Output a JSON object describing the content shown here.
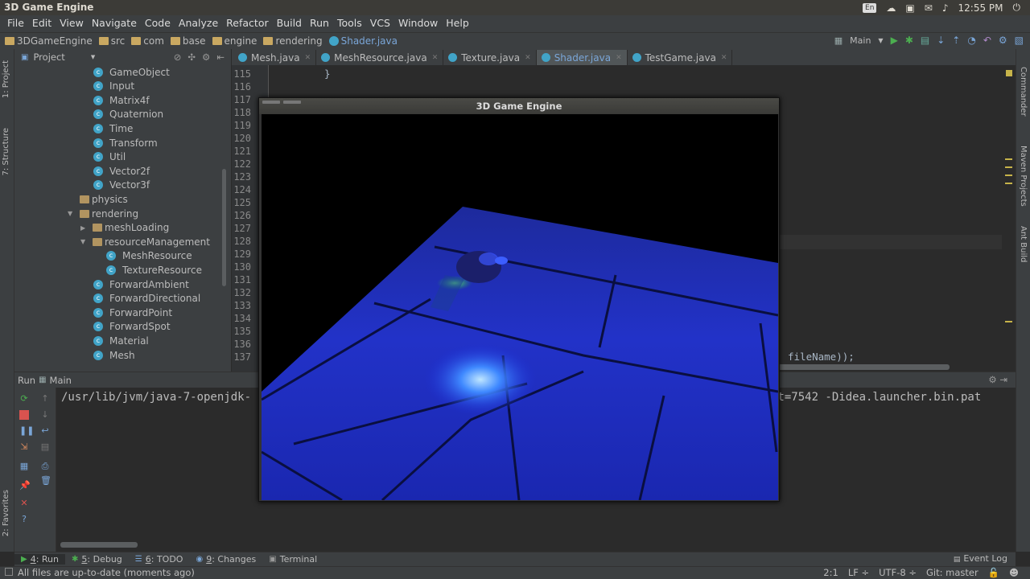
{
  "system": {
    "window_title": "3D Game Engine",
    "lang": "En",
    "clock": "12:55 PM"
  },
  "menu": [
    "File",
    "Edit",
    "View",
    "Navigate",
    "Code",
    "Analyze",
    "Refactor",
    "Build",
    "Run",
    "Tools",
    "VCS",
    "Window",
    "Help"
  ],
  "breadcrumb": [
    {
      "label": "3DGameEngine",
      "kind": "project"
    },
    {
      "label": "src",
      "kind": "folder"
    },
    {
      "label": "com",
      "kind": "folder"
    },
    {
      "label": "base",
      "kind": "folder"
    },
    {
      "label": "engine",
      "kind": "folder"
    },
    {
      "label": "rendering",
      "kind": "folder"
    },
    {
      "label": "Shader.java",
      "kind": "class"
    }
  ],
  "run_config": "Main",
  "left_tool_windows": [
    "1: Project",
    "7: Structure",
    "2: Favorites"
  ],
  "right_tool_windows": [
    "Commander",
    "Maven Projects",
    "Ant Build"
  ],
  "project_panel": {
    "title": "Project",
    "tree": [
      {
        "label": "GameObject",
        "kind": "class",
        "depth": 2
      },
      {
        "label": "Input",
        "kind": "class",
        "depth": 2
      },
      {
        "label": "Matrix4f",
        "kind": "class",
        "depth": 2
      },
      {
        "label": "Quaternion",
        "kind": "class",
        "depth": 2
      },
      {
        "label": "Time",
        "kind": "class",
        "depth": 2
      },
      {
        "label": "Transform",
        "kind": "class",
        "depth": 2
      },
      {
        "label": "Util",
        "kind": "class",
        "depth": 2
      },
      {
        "label": "Vector2f",
        "kind": "class",
        "depth": 2
      },
      {
        "label": "Vector3f",
        "kind": "class",
        "depth": 2
      },
      {
        "label": "physics",
        "kind": "folder",
        "depth": 1,
        "arrow": ""
      },
      {
        "label": "rendering",
        "kind": "folder",
        "depth": 1,
        "arrow": "▼"
      },
      {
        "label": "meshLoading",
        "kind": "folder",
        "depth": 2,
        "arrow": "▶"
      },
      {
        "label": "resourceManagement",
        "kind": "folder",
        "depth": 2,
        "arrow": "▼"
      },
      {
        "label": "MeshResource",
        "kind": "class",
        "depth": 3
      },
      {
        "label": "TextureResource",
        "kind": "class",
        "depth": 3
      },
      {
        "label": "ForwardAmbient",
        "kind": "class",
        "depth": 2
      },
      {
        "label": "ForwardDirectional",
        "kind": "class",
        "depth": 2
      },
      {
        "label": "ForwardPoint",
        "kind": "class",
        "depth": 2
      },
      {
        "label": "ForwardSpot",
        "kind": "class",
        "depth": 2
      },
      {
        "label": "Material",
        "kind": "class",
        "depth": 2
      },
      {
        "label": "Mesh",
        "kind": "class",
        "depth": 2
      }
    ]
  },
  "editor_tabs": [
    {
      "label": "Mesh.java",
      "active": false
    },
    {
      "label": "MeshResource.java",
      "active": false
    },
    {
      "label": "Texture.java",
      "active": false
    },
    {
      "label": "Shader.java",
      "active": true
    },
    {
      "label": "TestGame.java",
      "active": false
    }
  ],
  "line_numbers": [
    "115",
    "116",
    "117",
    "118",
    "119",
    "120",
    "121",
    "122",
    "123",
    "124",
    "125",
    "126",
    "127",
    "128",
    "129",
    "130",
    "131",
    "132",
    "133",
    "134",
    "135",
    "136",
    "137"
  ],
  "code_visible": {
    "line_115": "}",
    "line_137_tail": "fileName));"
  },
  "run_panel": {
    "title_run": "Run",
    "title_config": "Main",
    "console_left": "/usr/lib/jvm/java-7-openjdk-",
    "console_right": "rt=7542 -Didea.launcher.bin.pat"
  },
  "tool_tabs": [
    {
      "num": "4",
      "label": ": Run",
      "active": true
    },
    {
      "num": "5",
      "label": ": Debug",
      "active": false
    },
    {
      "num": "6",
      "label": ": TODO",
      "active": false
    },
    {
      "num": "9",
      "label": ": Changes",
      "active": false
    },
    {
      "num": "",
      "label": "Terminal",
      "active": false
    }
  ],
  "event_log": "Event Log",
  "status": {
    "message": "All files are up-to-date (moments ago)",
    "position": "2:1",
    "line_sep": "LF ÷",
    "encoding": "UTF-8 ÷",
    "vcs": "Git: master"
  },
  "game_window": {
    "title": "3D Game Engine"
  },
  "colors": {
    "accent_blue": "#7aa6d8",
    "class_icon": "#41a4c8",
    "floor": "#1a2bd6"
  }
}
